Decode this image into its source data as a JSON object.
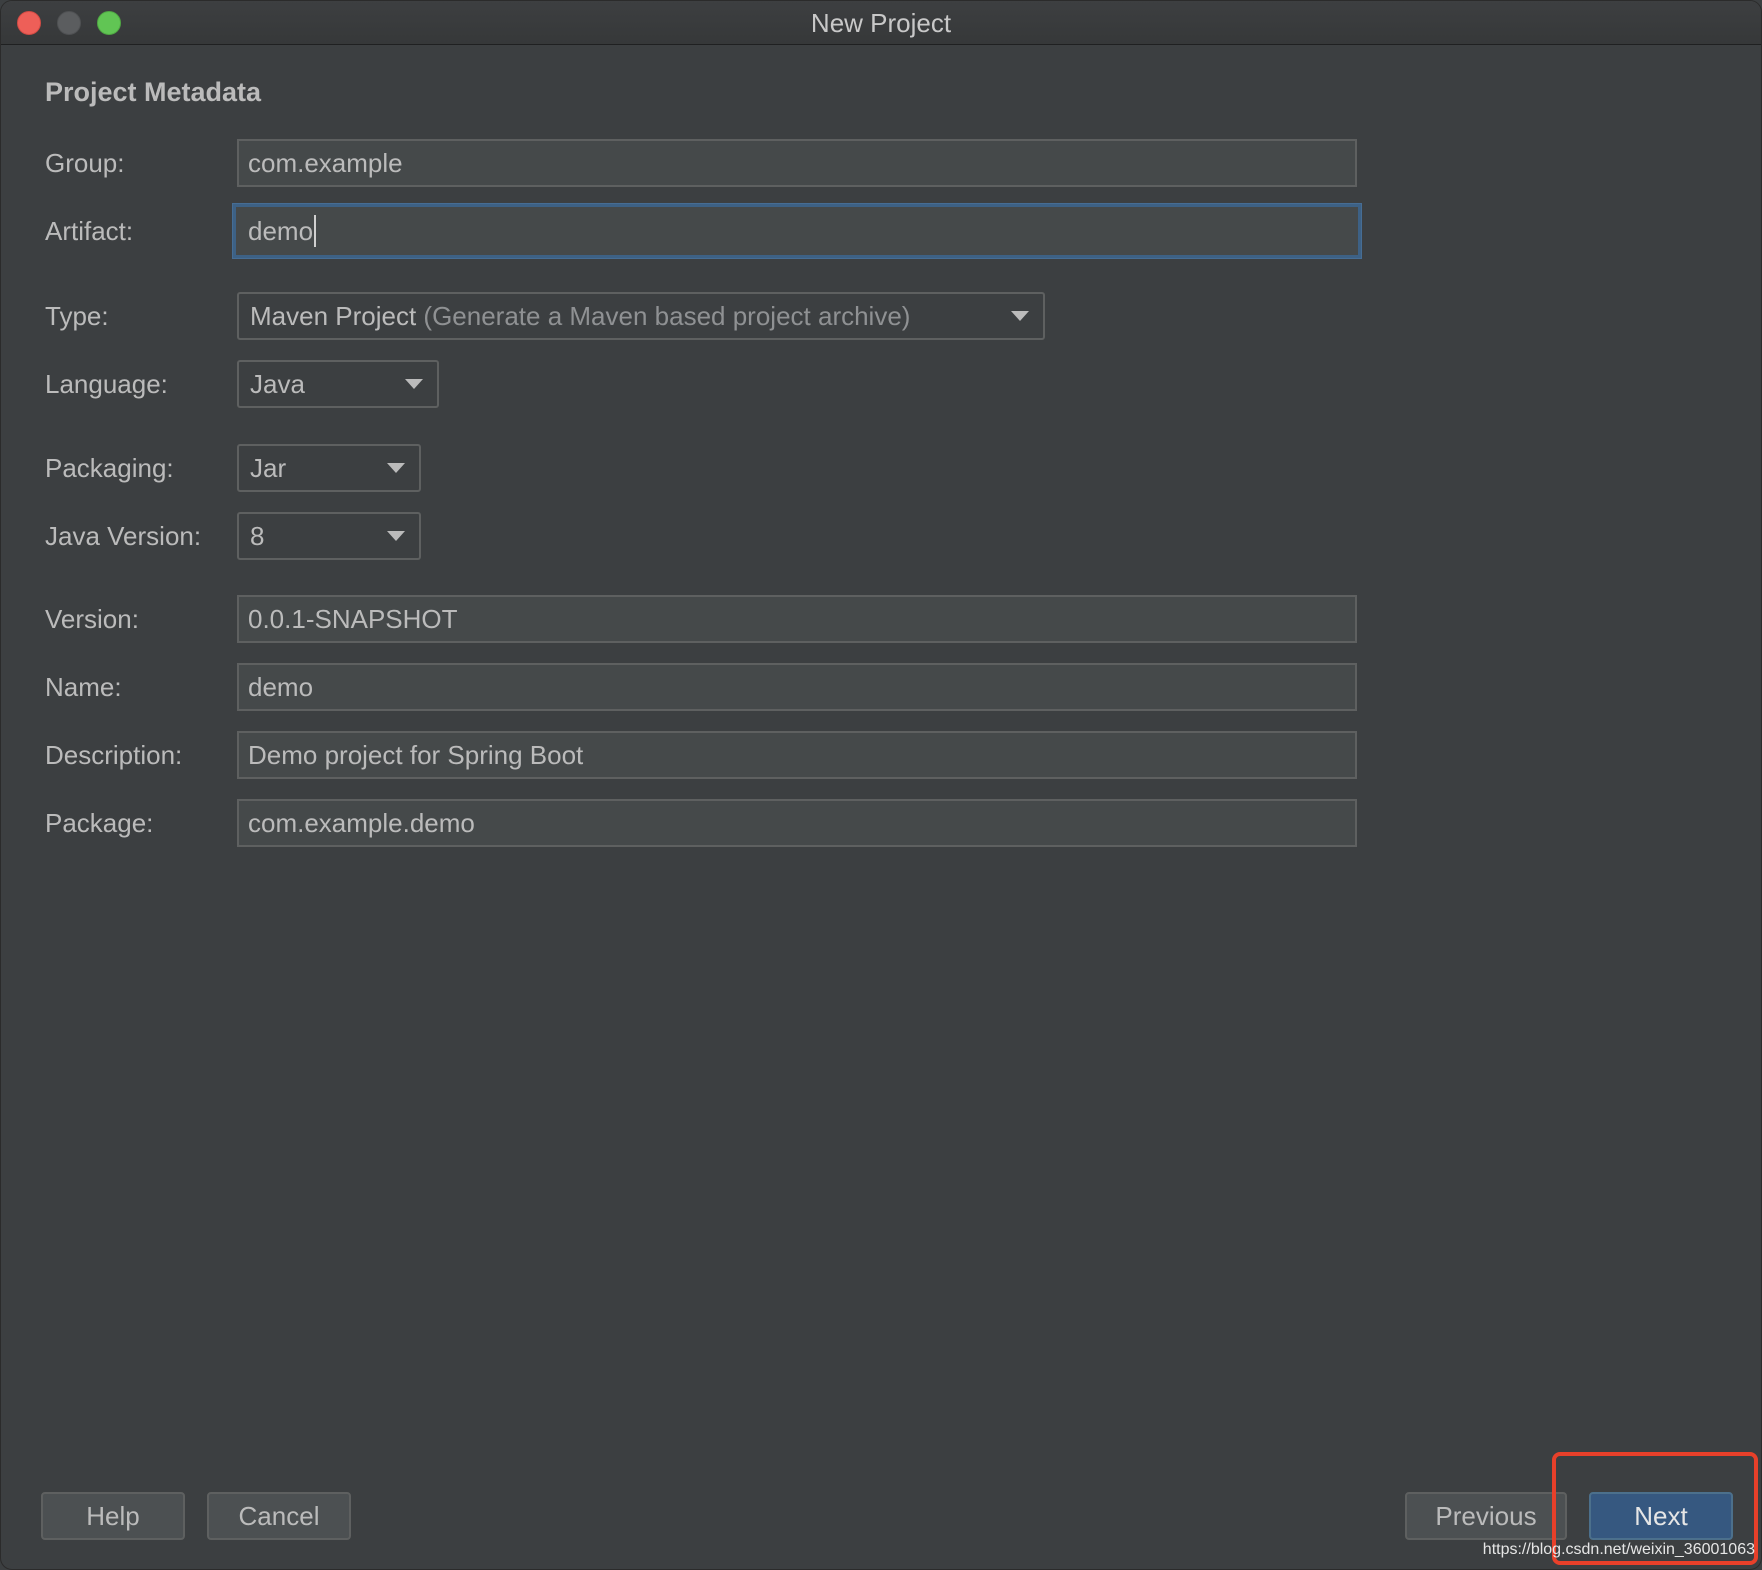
{
  "window": {
    "title": "New Project"
  },
  "section": {
    "title": "Project Metadata"
  },
  "fields": {
    "group": {
      "label": "Group:",
      "value": "com.example"
    },
    "artifact": {
      "label": "Artifact:",
      "value": "demo"
    },
    "type": {
      "label": "Type:",
      "value": "Maven Project",
      "hint": "(Generate a Maven based project archive)"
    },
    "language": {
      "label": "Language:",
      "value": "Java"
    },
    "packaging": {
      "label": "Packaging:",
      "value": "Jar"
    },
    "java_version": {
      "label": "Java Version:",
      "value": "8"
    },
    "version": {
      "label": "Version:",
      "value": "0.0.1-SNAPSHOT"
    },
    "name": {
      "label": "Name:",
      "value": "demo"
    },
    "description": {
      "label": "Description:",
      "value": "Demo project for Spring Boot"
    },
    "package": {
      "label": "Package:",
      "value": "com.example.demo"
    }
  },
  "buttons": {
    "help": "Help",
    "cancel": "Cancel",
    "previous": "Previous",
    "next": "Next"
  },
  "watermark": "https://blog.csdn.net/weixin_36001063",
  "colors": {
    "background": "#3c3f41",
    "focus_border": "#3d6185",
    "primary_button": "#365880",
    "annotation_red": "#e8402a"
  }
}
